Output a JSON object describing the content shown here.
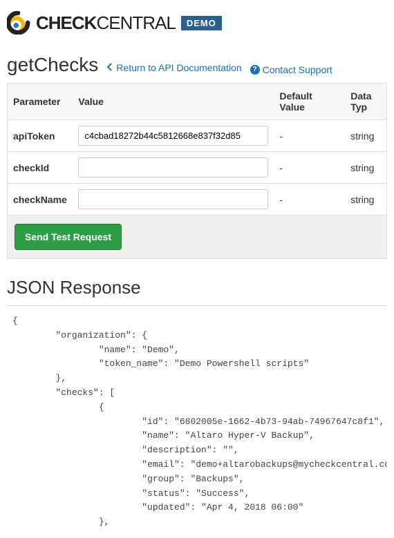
{
  "brand": {
    "part1": "CHECK",
    "part2": "CENTRAL",
    "badge": "DEMO"
  },
  "pageTitle": "getChecks",
  "links": {
    "back": "Return to API Documentation",
    "contact": "Contact Support"
  },
  "table": {
    "headers": {
      "param": "Parameter",
      "value": "Value",
      "default": "Default Value",
      "type": "Data Typ"
    },
    "rows": [
      {
        "param": "apiToken",
        "value": "c4cbad18272b44c5812668e837f32d85",
        "placeholder": "",
        "default": "-",
        "type": "string"
      },
      {
        "param": "checkId",
        "value": "",
        "placeholder": "",
        "default": "-",
        "type": "string"
      },
      {
        "param": "checkName",
        "value": "",
        "placeholder": "",
        "default": "-",
        "type": "string"
      }
    ]
  },
  "sendButton": "Send Test Request",
  "responseTitle": "JSON Response",
  "jsonResponse": "{\n        \"organization\": {\n                \"name\": \"Demo\",\n                \"token_name\": \"Demo Powershell scripts\"\n        },\n        \"checks\": [\n                {\n                        \"id\": \"6802005e-1662-4b73-94ab-74967647c8f1\",\n                        \"name\": \"Altaro Hyper-V Backup\",\n                        \"description\": \"\",\n                        \"email\": \"demo+altarobackups@mycheckcentral.cc\",\n                        \"group\": \"Backups\",\n                        \"status\": \"Success\",\n                        \"updated\": \"Apr 4, 2018 06:00\"\n                },"
}
